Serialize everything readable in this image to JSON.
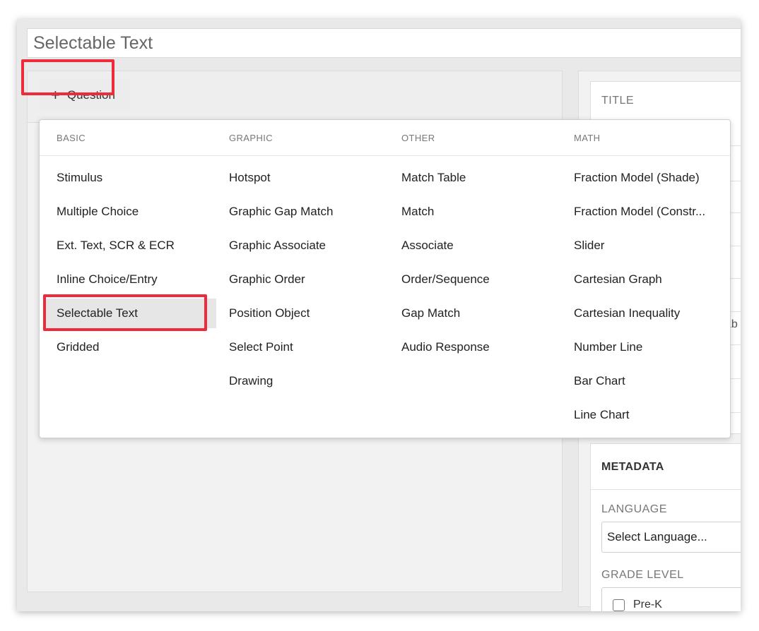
{
  "page": {
    "title": "Selectable Text"
  },
  "editor": {
    "add_question_label": "Question"
  },
  "picker": {
    "columns": [
      {
        "header": "BASIC",
        "items": [
          "Stimulus",
          "Multiple Choice",
          "Ext. Text, SCR & ECR",
          "Inline Choice/Entry",
          "Selectable Text",
          "Gridded"
        ]
      },
      {
        "header": "GRAPHIC",
        "items": [
          "Hotspot",
          "Graphic Gap Match",
          "Graphic Associate",
          "Graphic Order",
          "Position Object",
          "Select Point",
          "Drawing"
        ]
      },
      {
        "header": "OTHER",
        "items": [
          "Match Table",
          "Match",
          "Associate",
          "Order/Sequence",
          "Gap Match",
          "Audio Response"
        ]
      },
      {
        "header": "MATH",
        "items": [
          "Fraction Model (Shade)",
          "Fraction Model (Constr...",
          "Slider",
          "Cartesian Graph",
          "Cartesian Inequality",
          "Number Line",
          "Bar Chart",
          "Line Chart"
        ]
      }
    ],
    "selected_item": "Selectable Text"
  },
  "sidebar": {
    "title_label": "TITLE",
    "ghost_text": "ab",
    "metadata": {
      "heading": "METADATA",
      "language_label": "LANGUAGE",
      "language_value": "Select Language...",
      "grade_label": "GRADE LEVEL",
      "grade_first_option": "Pre-K"
    }
  },
  "colors": {
    "highlight": "#ee2b3a",
    "selected_bg": "#e6e6e6"
  }
}
